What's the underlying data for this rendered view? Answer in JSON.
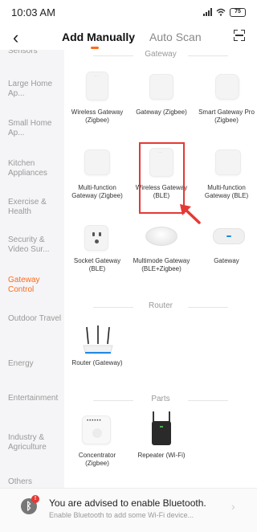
{
  "status_bar": {
    "time": "10:03 AM",
    "battery": "75"
  },
  "header": {
    "tabs": [
      "Add Manually",
      "Auto Scan"
    ]
  },
  "sidebar": {
    "items": [
      "Sensors",
      "Large Home Ap...",
      "Small Home Ap...",
      "Kitchen Appliances",
      "Exercise & Health",
      "Security & Video Sur...",
      "Gateway Control",
      "Outdoor Travel",
      "Energy",
      "Entertainment",
      "Industry & Agriculture",
      "Others"
    ],
    "active_index": 6,
    "active_color": "#ff6a1a"
  },
  "sections": {
    "gateway": "Gateway",
    "router": "Router",
    "parts": "Parts"
  },
  "devices": {
    "gateway": [
      "Wireless Gateway (Zigbee)",
      "Gateway (Zigbee)",
      "Smart Gateway Pro (Zigbee)",
      "Multi-function Gateway (Zigbee)",
      "Wireless Gateway (BLE)",
      "Multi-function Gateway (BLE)",
      "Socket Gateway (BLE)",
      "Multimode Gateway (BLE+Zigbee)",
      "Gateway"
    ],
    "router": [
      "Router (Gateway)"
    ],
    "parts": [
      "Concentrator (Zigbee)",
      "Repeater (Wi-Fi)"
    ]
  },
  "banner": {
    "title": "You are advised to enable Bluetooth.",
    "subtitle": "Enable Bluetooth to add some Wi-Fi device...",
    "badge": "!"
  },
  "highlight_color": "#e53935"
}
